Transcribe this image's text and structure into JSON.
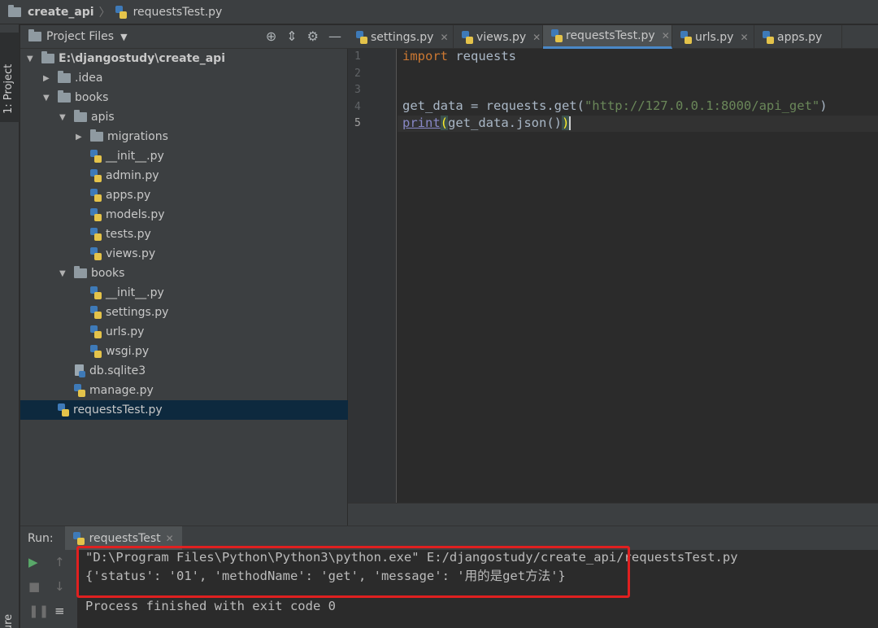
{
  "breadcrumb": {
    "project": "create_api",
    "file": "requestsTest.py"
  },
  "sidebar_strip": {
    "project_tab": "1: Project",
    "structure_tab": "ructure"
  },
  "project_panel": {
    "title": "Project Files",
    "tree": [
      {
        "label": "E:\\djangostudy\\create_api",
        "kind": "folder",
        "depth": 0,
        "expanded": true,
        "bold": true
      },
      {
        "label": ".idea",
        "kind": "folder",
        "depth": 1,
        "expanded": false
      },
      {
        "label": "books",
        "kind": "folder",
        "depth": 1,
        "expanded": true
      },
      {
        "label": "apis",
        "kind": "folder",
        "depth": 2,
        "expanded": true
      },
      {
        "label": "migrations",
        "kind": "folder",
        "depth": 3,
        "expanded": false
      },
      {
        "label": "__init__.py",
        "kind": "py",
        "depth": 3
      },
      {
        "label": "admin.py",
        "kind": "py",
        "depth": 3
      },
      {
        "label": "apps.py",
        "kind": "py",
        "depth": 3
      },
      {
        "label": "models.py",
        "kind": "py",
        "depth": 3
      },
      {
        "label": "tests.py",
        "kind": "py",
        "depth": 3
      },
      {
        "label": "views.py",
        "kind": "py",
        "depth": 3
      },
      {
        "label": "books",
        "kind": "folder",
        "depth": 2,
        "expanded": true
      },
      {
        "label": "__init__.py",
        "kind": "py",
        "depth": 3
      },
      {
        "label": "settings.py",
        "kind": "py",
        "depth": 3
      },
      {
        "label": "urls.py",
        "kind": "py",
        "depth": 3
      },
      {
        "label": "wsgi.py",
        "kind": "py",
        "depth": 3
      },
      {
        "label": "db.sqlite3",
        "kind": "db",
        "depth": 2
      },
      {
        "label": "manage.py",
        "kind": "py",
        "depth": 2
      },
      {
        "label": "requestsTest.py",
        "kind": "py",
        "depth": 1,
        "selected": true
      }
    ]
  },
  "editor_tabs": [
    {
      "label": "settings.py",
      "active": false
    },
    {
      "label": "views.py",
      "active": false
    },
    {
      "label": "requestsTest.py",
      "active": true
    },
    {
      "label": "urls.py",
      "active": false
    },
    {
      "label": "apps.py",
      "active": false
    }
  ],
  "editor": {
    "line_numbers": [
      "1",
      "2",
      "3",
      "4",
      "5"
    ],
    "current_line": "5",
    "code": {
      "l1_kw": "import",
      "l1_rest": " requests",
      "l4_a": "get_data = requests.get(",
      "l4_str": "\"http://127.0.0.1:8000/api_get\"",
      "l4_b": ")",
      "l5_print": "print",
      "l5_open": "(",
      "l5_mid": "get_data.json()",
      "l5_close": ")"
    }
  },
  "run_panel": {
    "label": "Run:",
    "tab": "requestsTest",
    "console": [
      "\"D:\\Program Files\\Python\\Python3\\python.exe\" E:/djangostudy/create_api/requestsTest.py",
      "{'status': '01', 'methodName': 'get', 'message': '用的是get方法'}",
      "",
      "Process finished with exit code 0"
    ]
  },
  "colors": {
    "highlight_box": "#e02020",
    "active_tab_underline": "#4a88c7"
  }
}
